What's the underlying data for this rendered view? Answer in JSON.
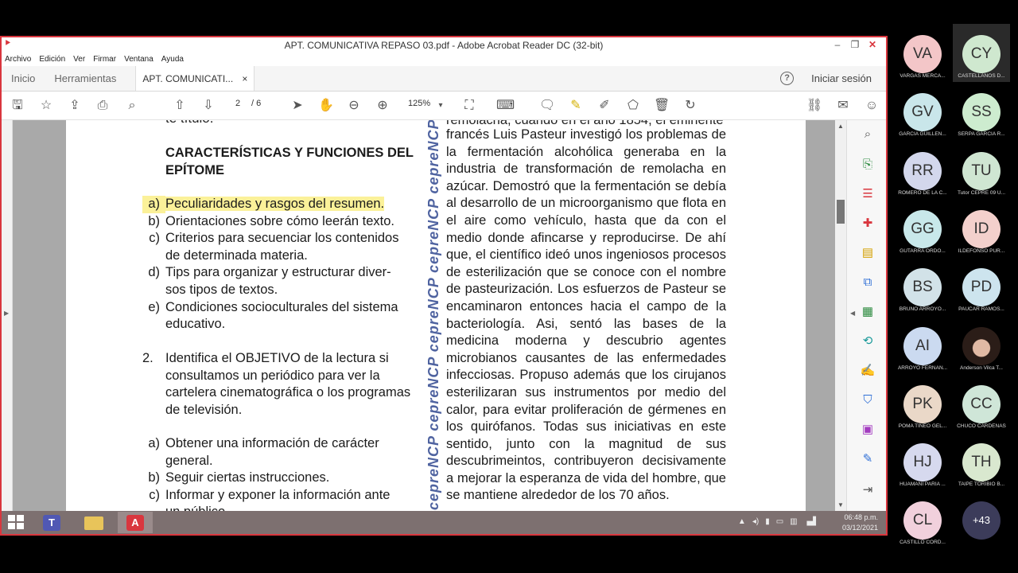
{
  "window": {
    "title": "APT. COMUNICATIVA REPASO 03.pdf - Adobe Acrobat Reader DC (32-bit)",
    "controls": [
      "‒",
      "❐",
      "✕"
    ]
  },
  "menu": [
    "Archivo",
    "Edición",
    "Ver",
    "Firmar",
    "Ventana",
    "Ayuda"
  ],
  "tabs": {
    "home": "Inicio",
    "tools": "Herramientas",
    "doc": "APT. COMUNICATI...",
    "close": "×",
    "signin": "Iniciar sesión"
  },
  "toolbar": {
    "page_current": "2",
    "page_total": "/ 6",
    "zoom": "125%"
  },
  "page": {
    "top_left_fragment": "te título.",
    "heading_line1": "CARACTERÍSTICAS Y FUNCIONES DEL",
    "heading_line2": "EPÍTOME",
    "list1": [
      {
        "label": "a)",
        "lines": [
          "Peculiaridades y rasgos del resumen."
        ]
      },
      {
        "label": "b)",
        "lines": [
          "Orientaciones sobre cómo leerán texto."
        ]
      },
      {
        "label": "c)",
        "lines": [
          "Criterios para secuenciar los contenidos",
          "de determinada materia."
        ]
      },
      {
        "label": "d)",
        "lines": [
          "Tips para organizar y estructurar diver-",
          "sos tipos de textos."
        ]
      },
      {
        "label": "e)",
        "lines": [
          "Condiciones socioculturales del sistema",
          "educativo."
        ]
      }
    ],
    "q2_number": "2.",
    "q2_text": "Identifica el OBJETIVO de la lectura si consultamos un periódico para ver la cartelera cinematográfica o los programas de televisión.",
    "list2": [
      {
        "label": "a)",
        "lines": [
          "Obtener una información de carácter",
          "general."
        ]
      },
      {
        "label": "b)",
        "lines": [
          "Seguir ciertas instrucciones."
        ]
      },
      {
        "label": "c)",
        "lines": [
          "Informar y exponer la información ante",
          "un público."
        ]
      }
    ],
    "watermark": "cepreNCP cepreNCP cepreNCP cepreNCP cepreNCP cepreNCP",
    "right_top_fragment": "remolacha, cuando en el año 1854, el eminente",
    "right_text": "francés Luis Pasteur investigó los problemas de la fermentación alcohólica generaba en la industria de transformación de remolacha en azúcar. Demostró que la fermentación se debía al desarrollo de un microorganismo que flota en el aire como vehículo, hasta que da con el medio donde afincarse y reproducirse. De ahí que, el científico ideó unos ingeniosos procesos de esterilización que se conoce con el nombre de pasteurización. Los esfuerzos de Pasteur se encaminaron entonces hacia el campo de la bacteriología. Asi, sentó las bases de la medicina moderna y descubrio agentes microbianos causantes de las enfermedades infecciosas. Propuso además que los cirujanos esterilizaran sus instrumentos por medio del calor, para evitar proliferación de gérmenes en los quirófanos. Todas sus iniciativas en este sentido, junto con la magnitud de sus descubrimeintos, contribuyeron decisivamente a mejorar la esperanza de vida del hombre, que se mantiene alrededor de los 70 años."
  },
  "taskbar": {
    "time": "06:48 p.m.",
    "date": "03/12/2021"
  },
  "participants": [
    {
      "initials": "VA",
      "name": "VARGAS MERCA...",
      "color": "#f3c6c8"
    },
    {
      "initials": "CY",
      "name": "CASTELLANOS D...",
      "color": "#cfe8cf",
      "selected": true
    },
    {
      "initials": "GV",
      "name": "GARCIA GUILLEN...",
      "color": "#c9e6ea"
    },
    {
      "initials": "SS",
      "name": "SERPA GARCIA R...",
      "color": "#cdeccf"
    },
    {
      "initials": "RR",
      "name": "ROMERO DE LA C...",
      "color": "#d3d7ec"
    },
    {
      "initials": "TU",
      "name": "Tutor CEPRE 09 U...",
      "color": "#cfe6d2"
    },
    {
      "initials": "GG",
      "name": "GUTARRA ORDÓ...",
      "color": "#c8e8ea"
    },
    {
      "initials": "ID",
      "name": "ILDEFONSO PUR...",
      "color": "#f3d0cc"
    },
    {
      "initials": "BS",
      "name": "BRUNO ARROYO...",
      "color": "#d2e2e8"
    },
    {
      "initials": "PD",
      "name": "PAUCAR RAMOS...",
      "color": "#cde4ee"
    },
    {
      "initials": "AI",
      "name": "ARROYO FERNAN...",
      "color": "#cbdaf0"
    },
    {
      "initials": "",
      "name": "Anderson Vilca T...",
      "color": "#8a6a5a",
      "photo": true
    },
    {
      "initials": "PK",
      "name": "POMA TINEO GEL...",
      "color": "#ead8c8"
    },
    {
      "initials": "CC",
      "name": "CHUCO CARDENAS",
      "color": "#cfe6d8"
    },
    {
      "initials": "HJ",
      "name": "HUAMANI PARIA ...",
      "color": "#d6d9ee"
    },
    {
      "initials": "TH",
      "name": "TAIPE TORIBIO B...",
      "color": "#d9e8cf"
    },
    {
      "initials": "CL",
      "name": "CASTILLO CORD...",
      "color": "#f1d0dc"
    }
  ],
  "more_participants": "+43",
  "colors": {
    "window_border": "#d9363e",
    "highlight": "#fbf199",
    "watermark": "#4f63a0",
    "taskbar": "#7d7070"
  }
}
